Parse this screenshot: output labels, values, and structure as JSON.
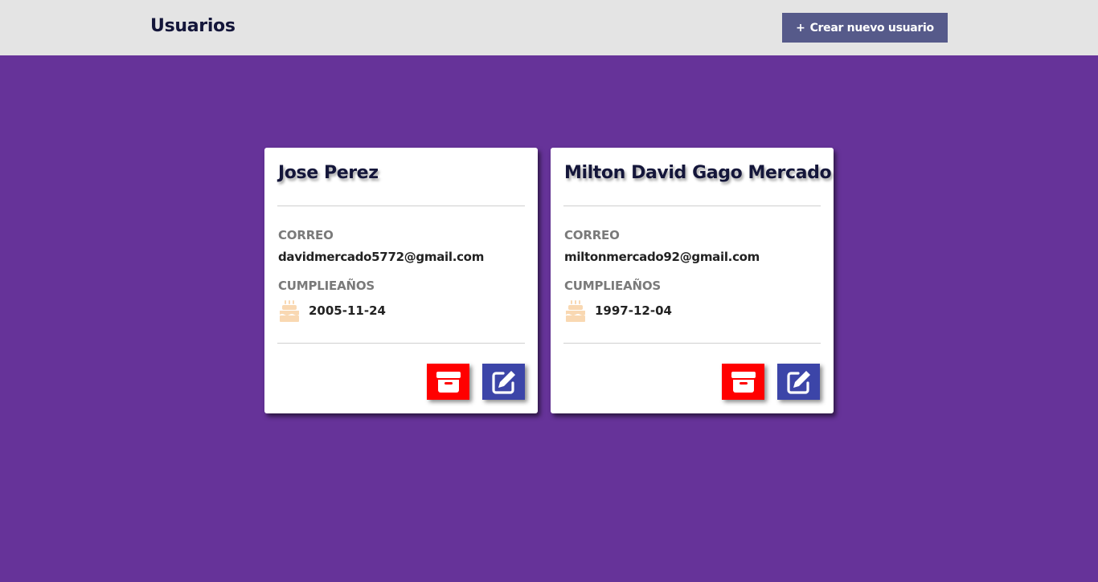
{
  "header": {
    "title": "Usuarios",
    "create_button": {
      "icon": "+",
      "label": "Crear nuevo usuario"
    }
  },
  "colors": {
    "background": "#663399",
    "header_bg": "#e4e4e4",
    "create_button_bg": "#565a8a",
    "delete_button_bg": "#ff0000",
    "edit_button_bg": "#3c45a8",
    "cake_icon": "#f9d8b2"
  },
  "users": [
    {
      "name": "Jose Perez",
      "email_label": "CORREO",
      "email": "davidmercado5772@gmail.com",
      "birthday_label": "CUMPLIEAÑOS",
      "birthday": "2005-11-24",
      "icons": {
        "birthday": "cake-icon",
        "delete": "archive-box-icon",
        "edit": "pen-to-square-icon"
      }
    },
    {
      "name": "Milton David Gago Mercado",
      "email_label": "CORREO",
      "email": "miltonmercado92@gmail.com",
      "birthday_label": "CUMPLIEAÑOS",
      "birthday": "1997-12-04",
      "icons": {
        "birthday": "cake-icon",
        "delete": "archive-box-icon",
        "edit": "pen-to-square-icon"
      }
    }
  ]
}
